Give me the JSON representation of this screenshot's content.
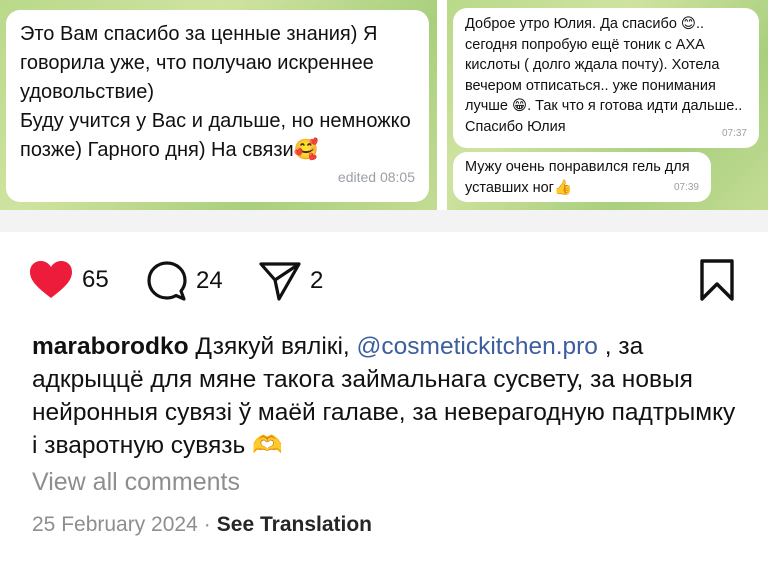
{
  "chat_left": {
    "message": "Это Вам спасибо за ценные знания) Я говорила уже, что получаю искреннее удовольствие)\nБуду учится у Вас и дальше, но немножко позже) Гарного дня) На связи🥰",
    "meta": "edited 08:05"
  },
  "chat_right": {
    "message1": "Доброе утро Юлия. Да спасибо 😊.. сегодня попробую ещё тоник с AXA кислоты ( долго ждала почту). Хотела вечером отписаться.. уже понимания лучше 😁. Так что я готова идти дальше.. Спасибо Юлия",
    "time1": "07:37",
    "message2": "Мужу очень понравился гель для уставших ног👍",
    "time2": "07:39"
  },
  "actions": {
    "likes": "65",
    "comments": "24",
    "shares": "2"
  },
  "caption": {
    "username": "maraborodko",
    "text_before": " Дзякуй вялікі, ",
    "mention": "@cosmetickitchen.pro",
    "text_after": " , за адкрыццё для мяне такога займальнага сусвету, за новыя нейронныя сувязі ў маёй галаве, за неверагодную падтрымку і зваротную сувязь 🫶"
  },
  "view_all": "View all comments",
  "date": "25 February 2024",
  "separator": "·",
  "see_translation": "See Translation",
  "colors": {
    "heart": "#ed1c3a",
    "mention": "#3c5e9e",
    "muted": "#8e8e8e",
    "chat_bg": "#c3dc94"
  },
  "icons": [
    "heart-icon",
    "comment-icon",
    "share-icon",
    "bookmark-icon"
  ]
}
